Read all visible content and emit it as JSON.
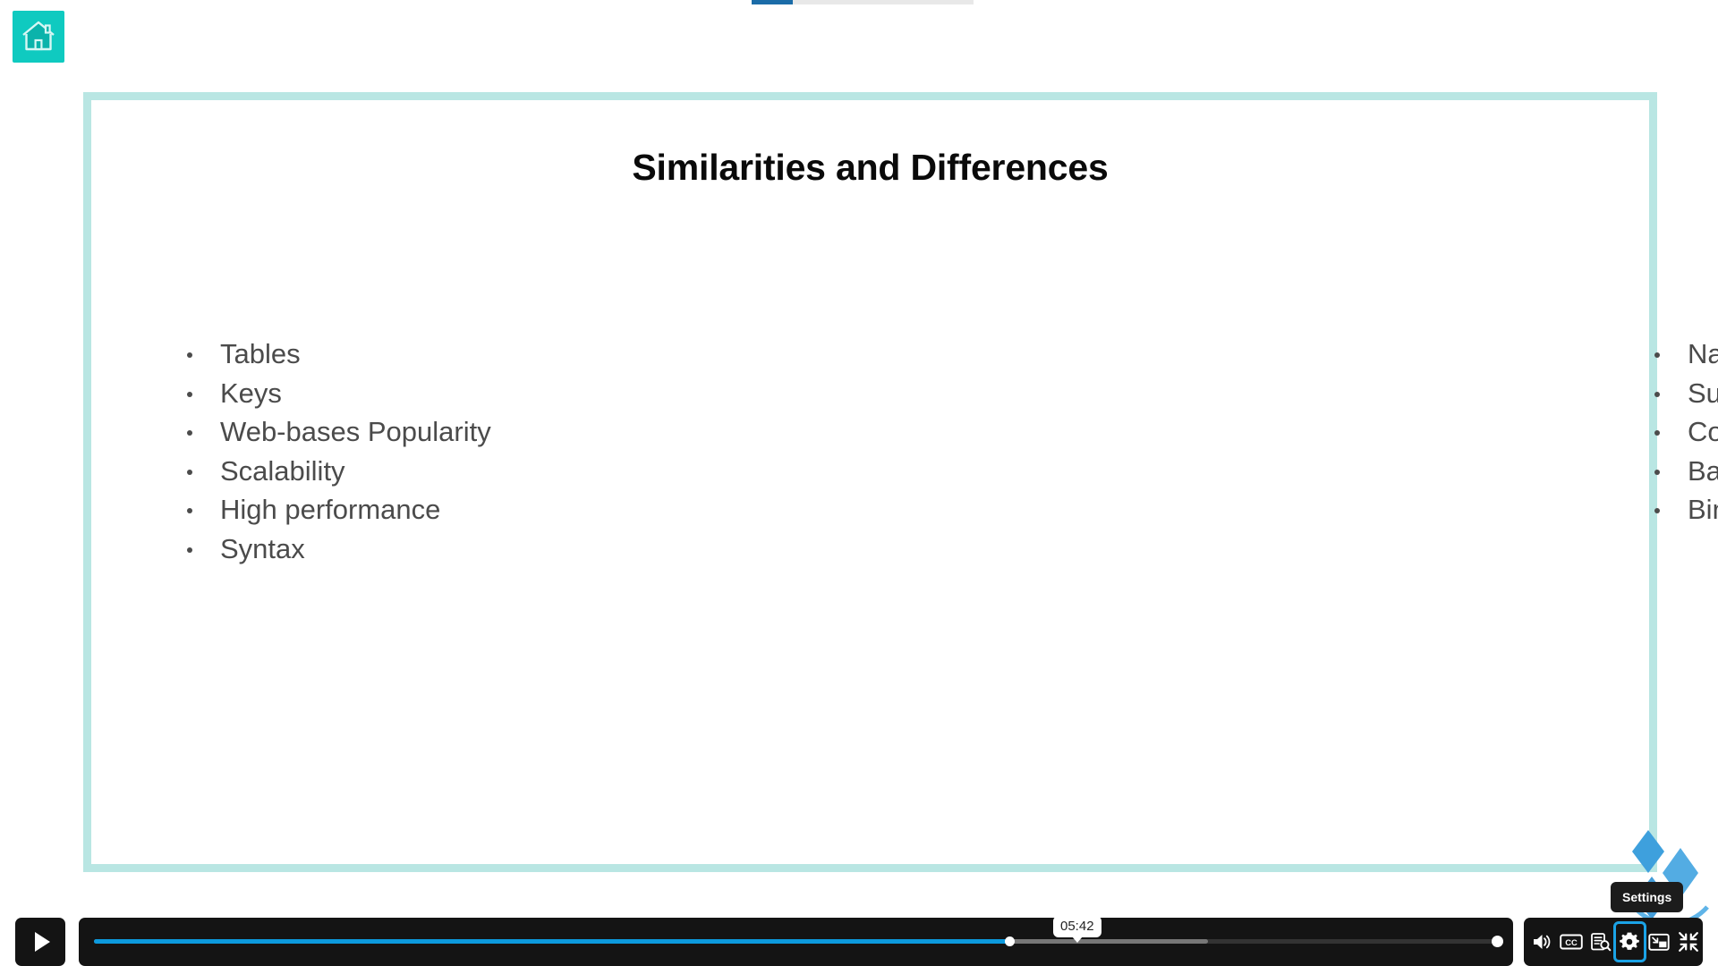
{
  "nav": {
    "home_button_label": "Home",
    "home_icon": "home-icon"
  },
  "top_progress": {
    "percent": 18
  },
  "slide": {
    "title": "Similarities and Differences",
    "border_color": "#b9e6e3",
    "text_color": "#4b4b4b",
    "columns": [
      {
        "name": "similarities",
        "bullets": [
          "Tables",
          "Keys",
          "Web-bases Popularity",
          "Scalability",
          "High performance",
          "Syntax"
        ]
      },
      {
        "name": "differences",
        "bullets": [
          "Native Compatibility",
          "Support",
          "Cost Efficiency",
          "Backup",
          "Binary Collections"
        ]
      }
    ]
  },
  "watermark": {
    "name": "logo-watermark",
    "color": "#2e9bd6"
  },
  "player": {
    "play_button": {
      "label": "Play",
      "icon": "play-icon"
    },
    "seek": {
      "current_time": "05:42",
      "played_percent": 65,
      "buffered_percent": 79
    },
    "tooltip": {
      "label": "Settings",
      "target": "settings-button"
    },
    "controls": [
      {
        "name": "volume-button",
        "icon": "volume-icon",
        "label": "Volume",
        "focused": false
      },
      {
        "name": "captions-button",
        "icon": "closed-captions-icon",
        "label": "CC",
        "focused": false
      },
      {
        "name": "transcript-button",
        "icon": "transcript-search-icon",
        "label": "Transcript",
        "focused": false
      },
      {
        "name": "settings-button",
        "icon": "gear-icon",
        "label": "Settings",
        "focused": true
      },
      {
        "name": "picture-in-picture-button",
        "icon": "picture-in-picture-icon",
        "label": "Picture in picture",
        "focused": false
      },
      {
        "name": "exit-fullscreen-button",
        "icon": "exit-fullscreen-icon",
        "label": "Exit fullscreen",
        "focused": false
      }
    ],
    "accent_color": "#0c9ade",
    "focus_ring_color": "#1ba3e6",
    "bar_color": "#141414"
  }
}
